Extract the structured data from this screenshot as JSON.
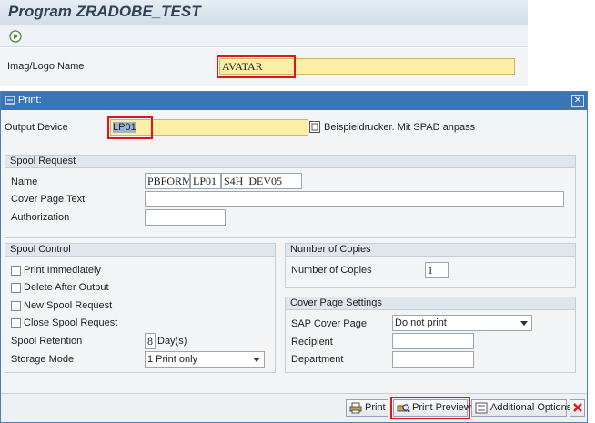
{
  "program": {
    "title": "Program ZRADOBE_TEST",
    "image_logo_label": "Imag/Logo Name",
    "image_logo_value": "AVATAR"
  },
  "dialog": {
    "title": "Print:",
    "output_device_label": "Output Device",
    "output_device_value": "LP01",
    "output_device_desc": "Beispieldrucker. Mit SPAD anpass",
    "spool_request": {
      "header": "Spool Request",
      "name_label": "Name",
      "name_parts": [
        "PBFORM",
        "LP01",
        "S4H_DEV05"
      ],
      "cover_text_label": "Cover Page Text",
      "cover_text_value": "",
      "authorization_label": "Authorization",
      "authorization_value": ""
    },
    "spool_control": {
      "header": "Spool Control",
      "print_immediately": "Print Immediately",
      "delete_after_output": "Delete After Output",
      "new_spool_request": "New Spool Request",
      "close_spool_request": "Close Spool Request",
      "retention_label": "Spool Retention",
      "retention_value": "8",
      "retention_unit": "Day(s)",
      "storage_label": "Storage Mode",
      "storage_value": "1 Print only"
    },
    "copies": {
      "header": "Number of Copies",
      "label": "Number of Copies",
      "value": "1"
    },
    "cover_page": {
      "header": "Cover Page Settings",
      "sap_cover_label": "SAP Cover Page",
      "sap_cover_value": "Do not print",
      "recipient_label": "Recipient",
      "recipient_value": "",
      "department_label": "Department",
      "department_value": ""
    },
    "buttons": {
      "print": "Print",
      "print_preview": "Print Preview",
      "additional_options": "Additional Options"
    }
  },
  "colors": {
    "highlight": "#e0141c",
    "title_bar": "#3a75b5",
    "required_field": "#fcefa5"
  }
}
